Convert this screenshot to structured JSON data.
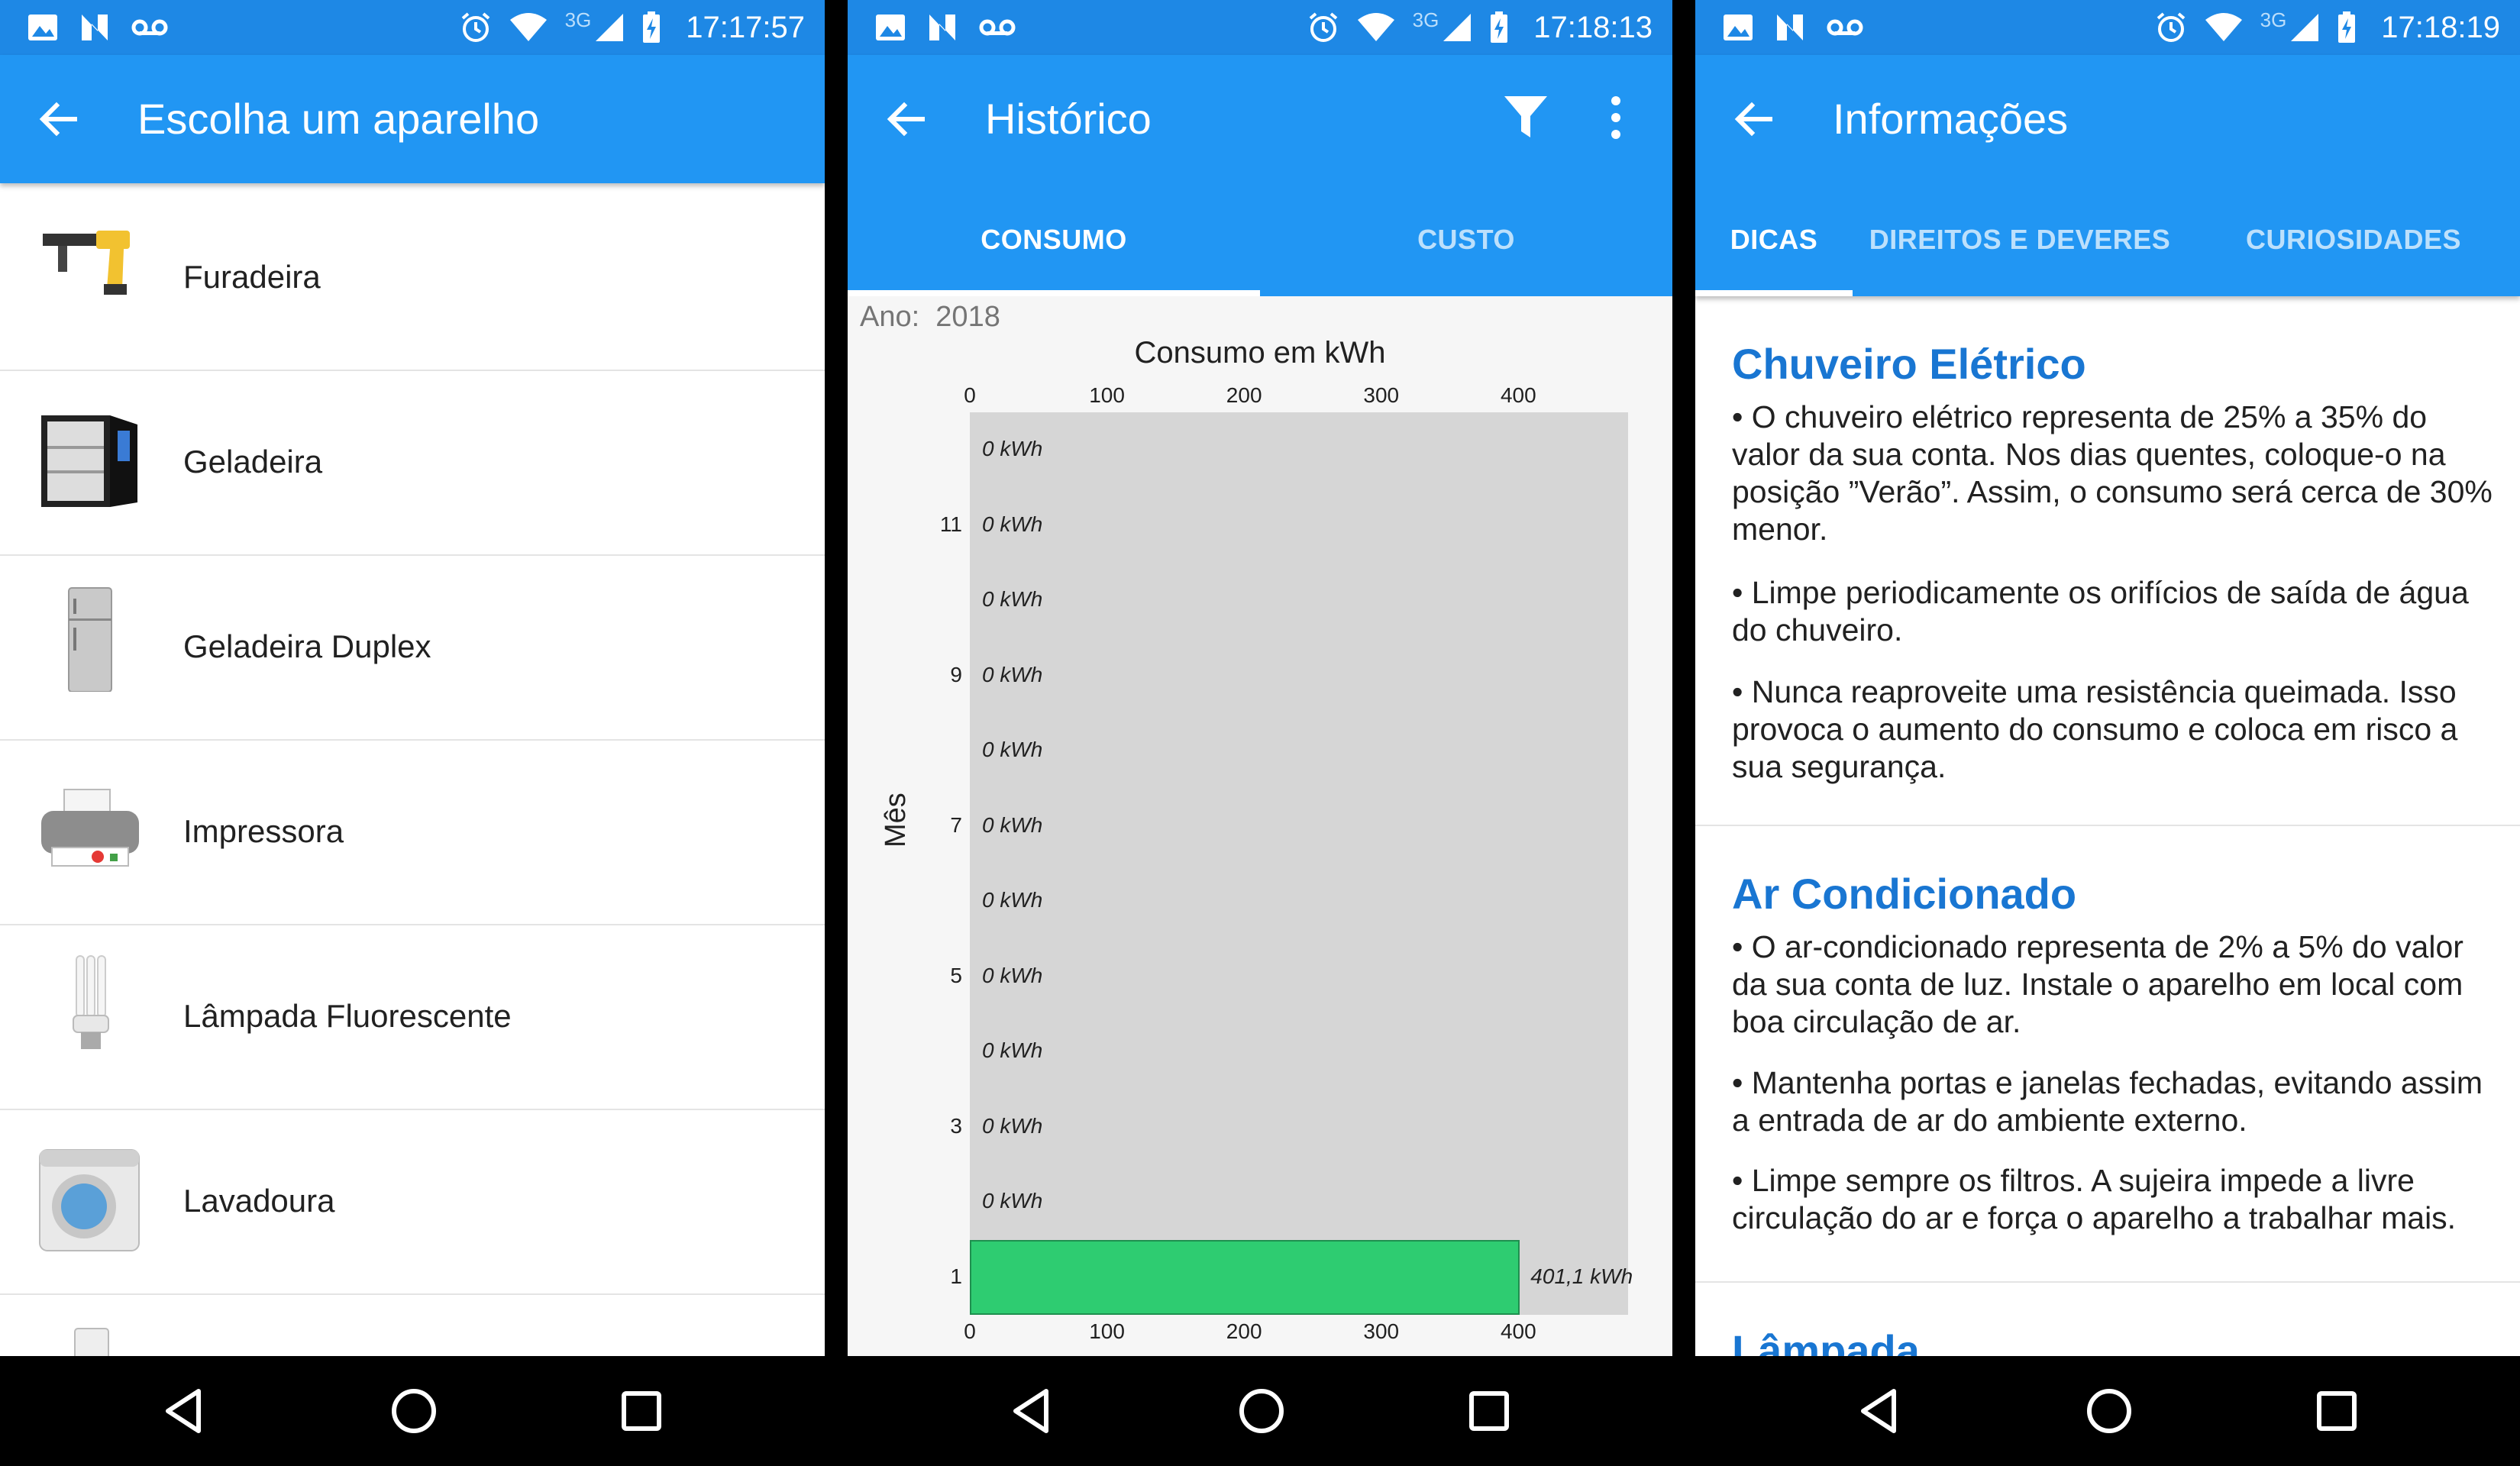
{
  "status_bar": {
    "time_1": "17:17:57",
    "time_2": "17:18:13",
    "time_3": "17:18:19",
    "network": "3G",
    "icons": [
      "image-icon",
      "n-icon",
      "voicemail-icon",
      "alarm-icon",
      "wifi-icon",
      "signal-icon",
      "battery-charging-icon"
    ]
  },
  "colors": {
    "primary": "#2196f3",
    "status": "#1e88e5",
    "bar": "#2ecc71",
    "title_blue": "#1976d2"
  },
  "screen1": {
    "title": "Escolha um aparelho",
    "items": [
      {
        "label": "Furadeira",
        "icon": "drill-icon"
      },
      {
        "label": "Geladeira",
        "icon": "fridge-icon"
      },
      {
        "label": "Geladeira Duplex",
        "icon": "duplex-fridge-icon"
      },
      {
        "label": "Impressora",
        "icon": "printer-icon"
      },
      {
        "label": "Lâmpada Fluorescente",
        "icon": "fluorescent-lamp-icon"
      },
      {
        "label": "Lavadoura",
        "icon": "washing-machine-icon"
      }
    ]
  },
  "screen2": {
    "title": "Histórico",
    "tabs": [
      "CONSUMO",
      "CUSTO"
    ],
    "year_label": "Ano:",
    "year_value": "2018"
  },
  "chart_data": {
    "type": "bar",
    "orientation": "horizontal",
    "title": "Consumo em kWh",
    "xlabel": "",
    "ylabel": "Mês",
    "xlim": [
      0,
      480
    ],
    "x_ticks": [
      0,
      100,
      200,
      300,
      400
    ],
    "categories": [
      12,
      11,
      10,
      9,
      8,
      7,
      6,
      5,
      4,
      3,
      2,
      1
    ],
    "category_tick_labels": [
      "",
      "11",
      "",
      "9",
      "",
      "7",
      "",
      "5",
      "",
      "3",
      "",
      "1"
    ],
    "values": [
      0,
      0,
      0,
      0,
      0,
      0,
      0,
      0,
      0,
      0,
      0,
      401.1
    ],
    "value_labels": [
      "0 kWh",
      "0 kWh",
      "0 kWh",
      "0 kWh",
      "0 kWh",
      "0 kWh",
      "0 kWh",
      "0 kWh",
      "0 kWh",
      "0 kWh",
      "0 kWh",
      "401,1 kWh"
    ],
    "grid": false,
    "bar_color": "#2ecc71",
    "background_color": "#d6d6d6"
  },
  "screen3": {
    "title": "Informações",
    "tabs": [
      "DICAS",
      "DIREITOS E DEVERES",
      "CURIOSIDADES"
    ],
    "sections": [
      {
        "title": "Chuveiro Elétrico",
        "tips": [
          "• O chuveiro elétrico representa de 25% a 35% do valor da sua conta. Nos dias quentes, coloque-o na posição ”Verão”. Assim, o consumo será cerca de 30% menor.",
          "• Limpe periodicamente os orifícios de saída de água do chuveiro.",
          "• Nunca reaproveite uma resistência queimada. Isso provoca o aumento do consumo e coloca em risco a sua segurança."
        ]
      },
      {
        "title": "Ar Condicionado",
        "tips": [
          "• O ar-condicionado representa de 2% a 5% do valor da sua conta de luz. Instale o aparelho em local com boa circulação de ar.",
          "• Mantenha portas e janelas fechadas, evitando assim a entrada de ar do ambiente externo.",
          "• Limpe sempre os filtros. A sujeira impede a livre circulação do ar e força o aparelho a trabalhar mais."
        ]
      },
      {
        "title": "Lâmpada",
        "tips": []
      }
    ]
  }
}
